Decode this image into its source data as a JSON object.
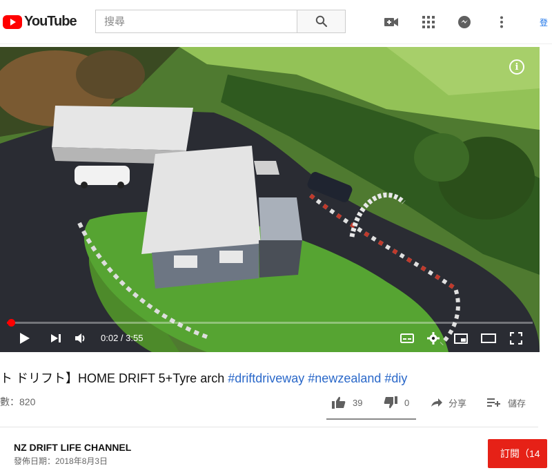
{
  "header": {
    "logo_text": "YouTube",
    "search_placeholder": "搜尋",
    "signin_fragment": "登"
  },
  "player": {
    "current_time": "0:02",
    "duration": "3:55",
    "time_display": "0:02 / 3:55",
    "progress_fraction": 0.0085,
    "info_glyph": "i"
  },
  "video": {
    "title_prefix": "ト ドリフト】HOME DRIFT 5+Tyre arch ",
    "hashtags": [
      "#driftdriveway",
      "#newzealand",
      "#diy"
    ],
    "views": "數：820",
    "likes": "39",
    "dislikes": "0",
    "share_label": "分享",
    "save_label": "儲存"
  },
  "channel": {
    "name": "NZ DRIFT LIFE CHANNEL",
    "published": "發佈日期：2018年8月3日",
    "subscribe_label": "訂閱（14"
  },
  "colors": {
    "brand_red": "#ff0000",
    "subscribe_red": "#e62117",
    "link_blue": "#2a68c9"
  },
  "icons": [
    "youtube-logo-icon",
    "search-icon",
    "video-camera-icon",
    "apps-grid-icon",
    "messages-icon",
    "more-vert-icon",
    "info-icon",
    "play-icon",
    "skip-next-icon",
    "volume-icon",
    "subtitles-icon",
    "settings-icon",
    "miniplayer-icon",
    "theater-icon",
    "fullscreen-icon",
    "thumbs-up-icon",
    "thumbs-down-icon",
    "share-icon",
    "save-playlist-icon"
  ]
}
